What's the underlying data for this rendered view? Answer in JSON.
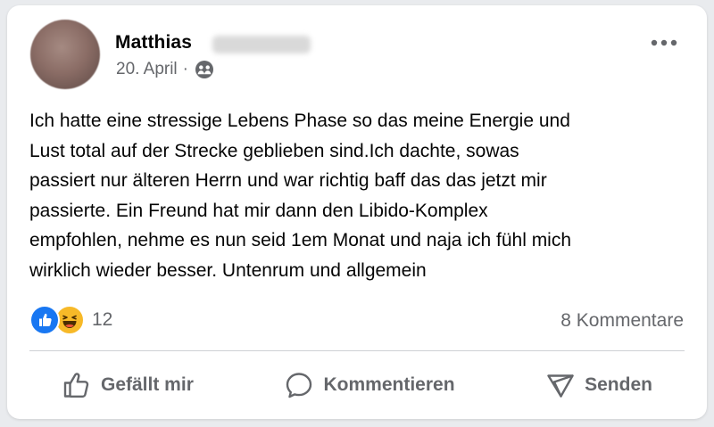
{
  "post": {
    "author_first_name": "Matthias",
    "date": "20. April",
    "separator": "·",
    "privacy_icon": "friends-icon",
    "more_icon": "more-horizontal-icon",
    "text": "Ich hatte eine stressige Lebens Phase so das meine Energie und\nLust total auf der Strecke geblieben sind.Ich dachte, sowas\npassiert nur älteren Herrn und war richtig baff das das jetzt mir\npassierte. Ein Freund hat mir dann den Libido-Komplex\nempfohlen, nehme es nun seid 1em Monat und naja ich fühl mich\nwirklich wieder besser. Untenrum und allgemein"
  },
  "stats": {
    "reaction_icons": [
      "like-reaction-icon",
      "haha-reaction-icon"
    ],
    "reaction_count": "12",
    "comments_label": "8 Kommentare"
  },
  "actions": {
    "like_label": "Gefällt mir",
    "comment_label": "Kommentieren",
    "share_label": "Senden"
  },
  "colors": {
    "like_blue": "#1877f2",
    "haha_yellow": "#f7b928",
    "secondary_text": "#65676b"
  }
}
